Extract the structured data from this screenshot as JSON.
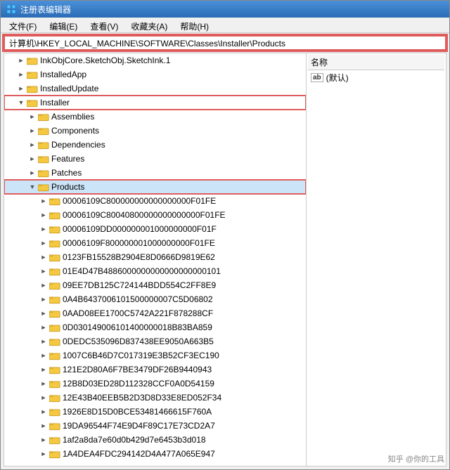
{
  "window": {
    "title": "注册表编辑器"
  },
  "menu": {
    "items": [
      {
        "label": "文件(F)"
      },
      {
        "label": "编辑(E)"
      },
      {
        "label": "查看(V)"
      },
      {
        "label": "收藏夹(A)"
      },
      {
        "label": "帮助(H)"
      }
    ]
  },
  "address_bar": {
    "value": "计算机\\HKEY_LOCAL_MACHINE\\SOFTWARE\\Classes\\Installer\\Products"
  },
  "tree": {
    "items": [
      {
        "id": "inkobj",
        "label": "InkObjCore.SketchObj.SketchInk.1",
        "indent": 2,
        "expanded": false,
        "highlight": false
      },
      {
        "id": "installedapp",
        "label": "InstalledApp",
        "indent": 2,
        "expanded": false,
        "highlight": false
      },
      {
        "id": "installedupdate",
        "label": "InstalledUpdate",
        "indent": 2,
        "expanded": false,
        "highlight": false
      },
      {
        "id": "installer",
        "label": "Installer",
        "indent": 2,
        "expanded": true,
        "highlight": true
      },
      {
        "id": "assemblies",
        "label": "Assemblies",
        "indent": 3,
        "expanded": false,
        "highlight": false
      },
      {
        "id": "components",
        "label": "Components",
        "indent": 3,
        "expanded": false,
        "highlight": false
      },
      {
        "id": "dependencies",
        "label": "Dependencies",
        "indent": 3,
        "expanded": false,
        "highlight": false
      },
      {
        "id": "features",
        "label": "Features",
        "indent": 3,
        "expanded": false,
        "highlight": false
      },
      {
        "id": "patches",
        "label": "Patches",
        "indent": 3,
        "expanded": false,
        "highlight": false
      },
      {
        "id": "products",
        "label": "Products",
        "indent": 3,
        "expanded": true,
        "highlight": true,
        "selected": true
      },
      {
        "id": "p1",
        "label": "00006109C800000000000000000F01FE",
        "indent": 4,
        "expanded": false,
        "highlight": false
      },
      {
        "id": "p2",
        "label": "00006109C80040800000000000000F01FE",
        "indent": 4,
        "expanded": false,
        "highlight": false
      },
      {
        "id": "p3",
        "label": "00006109DD000000001000000000F01F",
        "indent": 4,
        "expanded": false,
        "highlight": false
      },
      {
        "id": "p4",
        "label": "00006109F800000001000000000F01FE",
        "indent": 4,
        "expanded": false,
        "highlight": false
      },
      {
        "id": "p5",
        "label": "0123FB15528B2904E8D0666D9819E62",
        "indent": 4,
        "expanded": false,
        "highlight": false
      },
      {
        "id": "p6",
        "label": "01E4D47B4886000000000000000000101",
        "indent": 4,
        "expanded": false,
        "highlight": false
      },
      {
        "id": "p7",
        "label": "09EE7DB125C724144BDD554C2FF8E9",
        "indent": 4,
        "expanded": false,
        "highlight": false
      },
      {
        "id": "p8",
        "label": "0A4B6437006101500000007C5D06802",
        "indent": 4,
        "expanded": false,
        "highlight": false
      },
      {
        "id": "p9",
        "label": "0AAD08EE1700C5742A221F878288CF",
        "indent": 4,
        "expanded": false,
        "highlight": false
      },
      {
        "id": "p10",
        "label": "0D030149006101400000018B83BA859",
        "indent": 4,
        "expanded": false,
        "highlight": false
      },
      {
        "id": "p11",
        "label": "0DEDC535096D837438EE9050A663B5",
        "indent": 4,
        "expanded": false,
        "highlight": false
      },
      {
        "id": "p12",
        "label": "1007C6B46D7C017319E3B52CF3EC190",
        "indent": 4,
        "expanded": false,
        "highlight": false
      },
      {
        "id": "p13",
        "label": "121E2D80A6F7BE3479DF26B9440943",
        "indent": 4,
        "expanded": false,
        "highlight": false
      },
      {
        "id": "p14",
        "label": "12B8D03ED28D112328CCF0A0D54159",
        "indent": 4,
        "expanded": false,
        "highlight": false
      },
      {
        "id": "p15",
        "label": "12E43B40EEB5B2D3D8D33E8ED052F34",
        "indent": 4,
        "expanded": false,
        "highlight": false
      },
      {
        "id": "p16",
        "label": "1926E8D15D0BCE53481466615F760A",
        "indent": 4,
        "expanded": false,
        "highlight": false
      },
      {
        "id": "p17",
        "label": "19DA96544F74E9D4F89C17E73CD2A7",
        "indent": 4,
        "expanded": false,
        "highlight": false
      },
      {
        "id": "p18",
        "label": "1af2a8da7e60d0b429d7e6453b3d018",
        "indent": 4,
        "expanded": false,
        "highlight": false
      },
      {
        "id": "p19",
        "label": "1A4DEA4FDC294142D4A477A065E947",
        "indent": 4,
        "expanded": false,
        "highlight": false
      }
    ]
  },
  "right_panel": {
    "column_label": "名称",
    "items": [
      {
        "icon": "ab",
        "label": "(默认)"
      }
    ]
  },
  "watermark": "知乎 @你的工具"
}
